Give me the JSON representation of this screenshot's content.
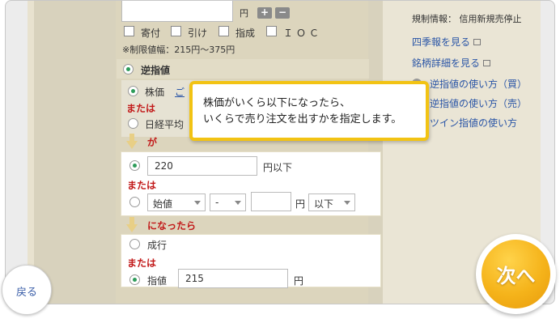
{
  "form": {
    "yen_unit": "円",
    "plus": "+",
    "minus": "−",
    "conditions": [
      "寄付",
      "引け",
      "指成",
      "ＩＯＣ"
    ],
    "limit_range": "※制限値幅：215円〜375円",
    "stop_order_label": "逆指値",
    "stock_price_label": "株価",
    "stock_price_link": "ご",
    "or_1": "または",
    "nikkei_label": "日経平均",
    "ga": "が",
    "trigger_price": "220",
    "trigger_suffix": "円以下",
    "or_2": "または",
    "open_price_select": "始値",
    "dash_select": "-",
    "range_yen": "円",
    "range_select": "以下",
    "became_label": "になったら",
    "market_order_label": "成行",
    "or_3": "または",
    "limit_label": "指値",
    "limit_price": "215",
    "limit_yen": "円"
  },
  "right_panel": {
    "regulation": "規制情報： 信用新規売停止",
    "links": [
      "四季報を見る",
      "銘柄詳細を見る"
    ],
    "help_links": [
      "逆指値の使い方（買）",
      "逆指値の使い方（売）",
      "ツイン指値の使い方"
    ]
  },
  "callout": {
    "text": "株価がいくら以下になったら、\nいくらで売り注文を出すかを指定します。"
  },
  "nav": {
    "back_label": "戻る",
    "next_label": "次へ"
  },
  "colors": {
    "callout_border": "#f2c313",
    "next_button": "#f5b31a",
    "radio_selected": "#2e9c5a",
    "emphasis_red": "#c21a1a",
    "link_blue": "#2a55a6"
  }
}
